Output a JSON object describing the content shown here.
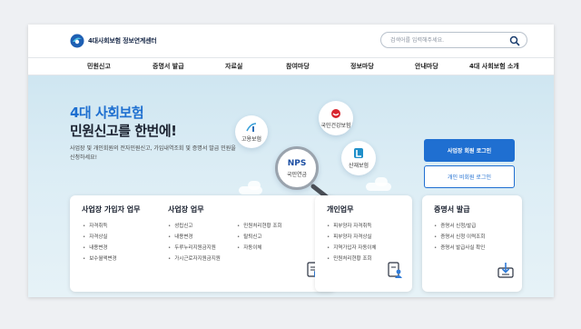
{
  "header": {
    "logo_text": "4대사회보험 정보연계센터",
    "search_placeholder": "검색어를 입력해주세요."
  },
  "nav": {
    "items": [
      "민원신고",
      "증명서 발급",
      "자료실",
      "참여마당",
      "정보마당",
      "안내마당",
      "4대 사회보험 소개"
    ]
  },
  "hero": {
    "title_line1": "4대 사회보험",
    "title_line2": "민원신고를 한번에!",
    "desc": "사업장 및 개인회원의 전자민원신고, 가입내역조회 및 증명서 발급 민원을 신청하세요!",
    "badges": {
      "employment": "고용보험",
      "health": "국민건강보험",
      "pension_logo": "NPS",
      "pension": "국민연금",
      "industrial": "산재보험"
    }
  },
  "login": {
    "corp": "사업장 회원 로그인",
    "individual": "개인 비회원 로그인"
  },
  "cards": {
    "workplace_join": {
      "title": "사업장 가입자 업무",
      "items": [
        "자격취득",
        "자격상실",
        "내용변경",
        "보수월액변경"
      ]
    },
    "workplace": {
      "title": "사업장 업무",
      "items_col1": [
        "성립신고",
        "내용변경",
        "두루누리지원금지원",
        "가시근로자지원금지원"
      ],
      "items_col2": [
        "민원처리현황 조회",
        "탈퇴신고",
        "자동이체"
      ]
    },
    "personal": {
      "title": "개인업무",
      "items": [
        "피부양자 자격취득",
        "피부양자 자격상실",
        "지역가입자 자동이체",
        "민원처리현황 조회"
      ]
    },
    "certificate": {
      "title": "증명서 발급",
      "items": [
        "증명서 신청/발급",
        "증명서 신청 이력조회",
        "증명서 발급사실 확인"
      ]
    }
  },
  "colors": {
    "primary_blue": "#1f6fd1",
    "hero_bg": "#d6eaf3",
    "title_dark": "#1b2230"
  }
}
